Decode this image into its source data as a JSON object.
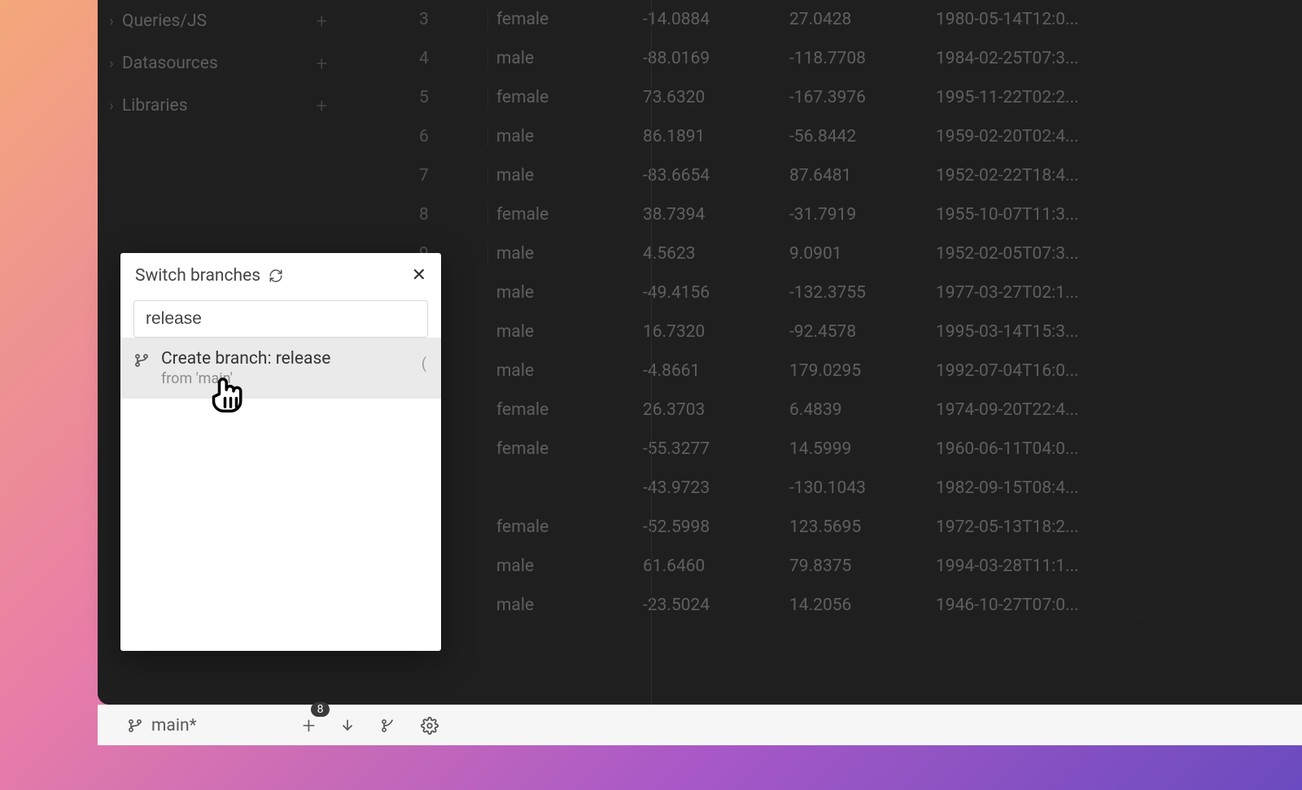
{
  "sidebar": {
    "items": [
      {
        "label": "Queries/JS"
      },
      {
        "label": "Datasources"
      },
      {
        "label": "Libraries"
      }
    ]
  },
  "table": {
    "rows": [
      {
        "idx": "3",
        "gender": "female",
        "lat": "-14.0884",
        "lon": "27.0428",
        "date": "1980-05-14T12:0..."
      },
      {
        "idx": "4",
        "gender": "male",
        "lat": "-88.0169",
        "lon": "-118.7708",
        "date": "1984-02-25T07:3..."
      },
      {
        "idx": "5",
        "gender": "female",
        "lat": "73.6320",
        "lon": "-167.3976",
        "date": "1995-11-22T02:2..."
      },
      {
        "idx": "6",
        "gender": "male",
        "lat": "86.1891",
        "lon": "-56.8442",
        "date": "1959-02-20T02:4..."
      },
      {
        "idx": "7",
        "gender": "male",
        "lat": "-83.6654",
        "lon": "87.6481",
        "date": "1952-02-22T18:4..."
      },
      {
        "idx": "8",
        "gender": "female",
        "lat": "38.7394",
        "lon": "-31.7919",
        "date": "1955-10-07T11:3..."
      },
      {
        "idx": "9",
        "gender": "male",
        "lat": "4.5623",
        "lon": "9.0901",
        "date": "1952-02-05T07:3..."
      },
      {
        "idx": "",
        "gender": "male",
        "lat": "-49.4156",
        "lon": "-132.3755",
        "date": "1977-03-27T02:1..."
      },
      {
        "idx": "",
        "gender": "male",
        "lat": "16.7320",
        "lon": "-92.4578",
        "date": "1995-03-14T15:3..."
      },
      {
        "idx": "",
        "gender": "male",
        "lat": "-4.8661",
        "lon": "179.0295",
        "date": "1992-07-04T16:0..."
      },
      {
        "idx": "",
        "gender": "female",
        "lat": "26.3703",
        "lon": "6.4839",
        "date": "1974-09-20T22:4..."
      },
      {
        "idx": "",
        "gender": "female",
        "lat": "-55.3277",
        "lon": "14.5999",
        "date": "1960-06-11T04:0..."
      },
      {
        "idx": "",
        "gender": "",
        "lat": "-43.9723",
        "lon": "-130.1043",
        "date": "1982-09-15T08:4..."
      },
      {
        "idx": "",
        "gender": "female",
        "lat": "-52.5998",
        "lon": "123.5695",
        "date": "1972-05-13T18:2..."
      },
      {
        "idx": "",
        "gender": "male",
        "lat": "61.6460",
        "lon": "79.8375",
        "date": "1994-03-28T11:1..."
      },
      {
        "idx": "",
        "gender": "male",
        "lat": "-23.5024",
        "lon": "14.2056",
        "date": "1946-10-27T07:0..."
      }
    ]
  },
  "popover": {
    "title": "Switch branches",
    "input_value": "release",
    "option_title": "Create branch: release",
    "option_sub": "from 'main'"
  },
  "bottombar": {
    "branch_label": "main*",
    "badge_count": "8"
  }
}
